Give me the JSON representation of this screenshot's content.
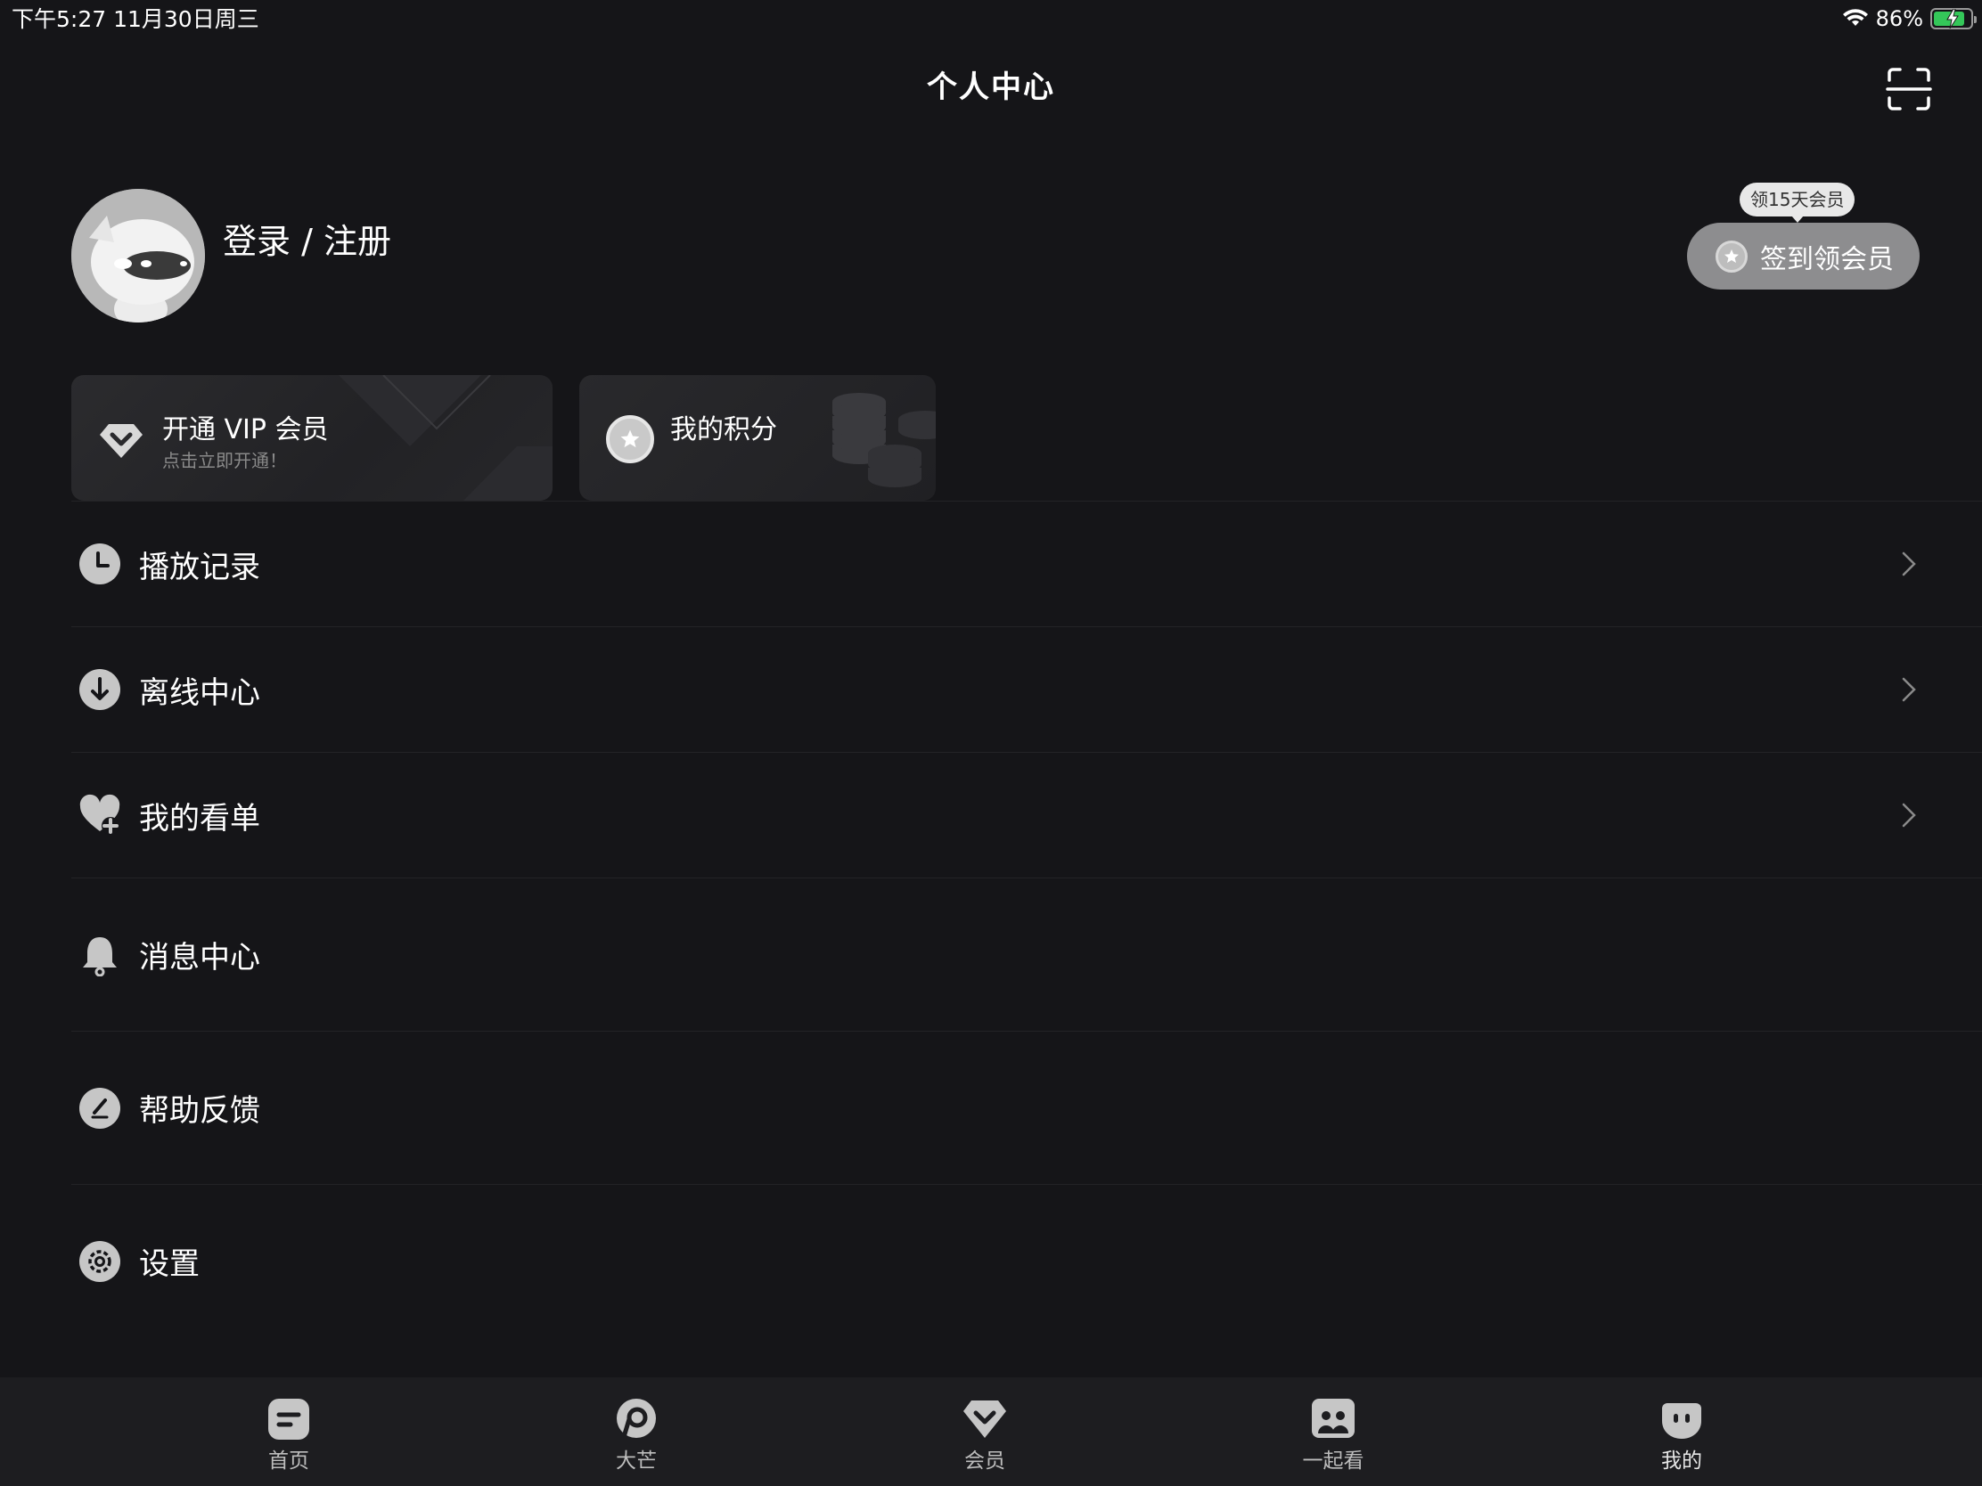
{
  "status_bar": {
    "time": "下午5:27   11月30日周三",
    "battery_pct": "86%",
    "battery_level": 0.86
  },
  "header": {
    "title": "个人中心"
  },
  "profile": {
    "login_label": "登录 / 注册",
    "tip_bubble": "领15天会员",
    "checkin_label": "签到领会员"
  },
  "cards": {
    "vip": {
      "title": "开通 VIP 会员",
      "subtitle": "点击立即开通！"
    },
    "points": {
      "title": "我的积分"
    }
  },
  "menu": {
    "items": [
      {
        "label": "播放记录",
        "icon": "clock-icon",
        "chevron": true
      },
      {
        "label": "离线中心",
        "icon": "download-icon",
        "chevron": true
      },
      {
        "label": "我的看单",
        "icon": "heart-plus-icon",
        "chevron": true
      },
      {
        "label": "消息中心",
        "icon": "bell-icon",
        "chevron": false
      },
      {
        "label": "帮助反馈",
        "icon": "feedback-icon",
        "chevron": false
      },
      {
        "label": "设置",
        "icon": "gear-icon",
        "chevron": false
      }
    ]
  },
  "tabbar": {
    "tabs": [
      {
        "label": "首页",
        "icon": "home-icon"
      },
      {
        "label": "大芒",
        "icon": "mango-icon"
      },
      {
        "label": "会员",
        "icon": "vip-heart-icon"
      },
      {
        "label": "一起看",
        "icon": "watch-together-icon"
      },
      {
        "label": "我的",
        "icon": "mine-icon",
        "active": true
      }
    ]
  },
  "colors": {
    "background": "#151518",
    "tabbar": "#1d1d20",
    "checkin_button": "#8d8d8f",
    "battery_fill": "#34c759"
  }
}
